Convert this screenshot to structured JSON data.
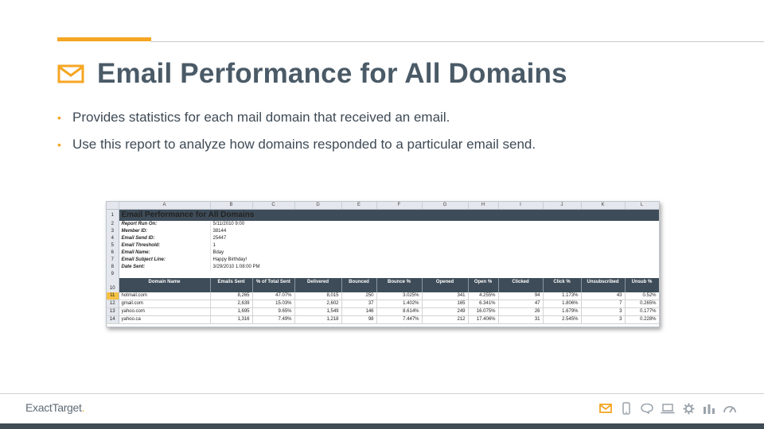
{
  "slide": {
    "title": "Email Performance for All Domains",
    "bullets": [
      "Provides statistics for each mail domain that received an email.",
      "Use this report to analyze how domains responded to a particular email send."
    ],
    "accent_color": "#f5a623",
    "title_color": "#4a5a67"
  },
  "spreadsheet": {
    "columns": [
      "A",
      "B",
      "C",
      "D",
      "E",
      "F",
      "G",
      "H",
      "I",
      "J",
      "K",
      "L"
    ],
    "row_numbers": [
      "1",
      "2",
      "3",
      "4",
      "5",
      "6",
      "7",
      "8",
      "9",
      "10",
      "11",
      "12",
      "13",
      "14"
    ],
    "title": "Email Performance for All Domains",
    "meta": [
      {
        "label": "Report Run On:",
        "value": "5/11/2010 9:00"
      },
      {
        "label": "Member ID:",
        "value": "38144"
      },
      {
        "label": "Email Send ID:",
        "value": "25447"
      },
      {
        "label": "Email Threshold:",
        "value": "1"
      },
      {
        "label": "Email Name:",
        "value": "Bday"
      },
      {
        "label": "Email Subject Line:",
        "value": "Happy Birthday!"
      },
      {
        "label": "Date Sent:",
        "value": "3/29/2010 1:08:00 PM"
      }
    ],
    "headers": [
      "Domain Name",
      "Emails Sent",
      "% of Total Sent",
      "Delivered",
      "Bounced",
      "Bounce %",
      "Opened",
      "Open %",
      "Clicked",
      "Click %",
      "Unsubscribed",
      "Unsub %"
    ],
    "rows": [
      [
        "hotmail.com",
        "8,265",
        "47.07%",
        "8,015",
        "250",
        "3.025%",
        "341",
        "4.255%",
        "94",
        "1.173%",
        "43",
        "0.52%"
      ],
      [
        "gmail.com",
        "2,639",
        "15.03%",
        "2,602",
        "37",
        "1.402%",
        "165",
        "6.341%",
        "47",
        "1.806%",
        "7",
        "0.265%"
      ],
      [
        "yahoo.com",
        "1,695",
        "9.65%",
        "1,549",
        "146",
        "8.614%",
        "249",
        "16.075%",
        "26",
        "1.679%",
        "3",
        "0.177%"
      ],
      [
        "yahoo.ca",
        "1,316",
        "7.49%",
        "1,218",
        "98",
        "7.447%",
        "212",
        "17.406%",
        "31",
        "2.545%",
        "3",
        "0.228%"
      ]
    ]
  },
  "footer": {
    "logo": "ExactTarget",
    "logo_mark": ".",
    "icons": [
      "mail-icon",
      "mobile-icon",
      "chat-icon",
      "laptop-icon",
      "gear-icon",
      "bar-chart-icon",
      "gauge-icon"
    ]
  }
}
